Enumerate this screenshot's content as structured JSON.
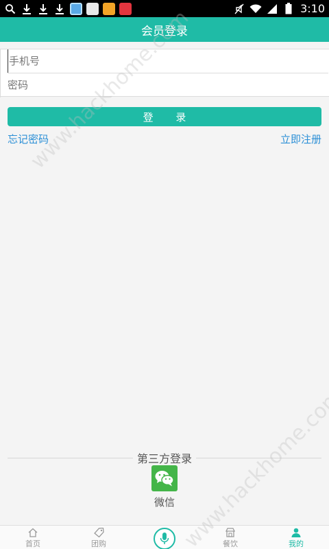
{
  "status_bar": {
    "time": "3:10",
    "left_icons": [
      "search-icon",
      "download-icon",
      "download-icon",
      "download-icon",
      "app-icon-1",
      "app-icon-2",
      "app-icon-3",
      "app-icon-4"
    ],
    "right_icons": [
      "mute-icon",
      "wifi-icon",
      "signal-icon",
      "battery-icon"
    ]
  },
  "header": {
    "title": "会员登录"
  },
  "form": {
    "phone_placeholder": "手机号",
    "password_placeholder": "密码"
  },
  "login_button": {
    "label": "登 录"
  },
  "links": {
    "forgot": "忘记密码",
    "register": "立即注册"
  },
  "third_party": {
    "title": "第三方登录",
    "wechat_label": "微信"
  },
  "bottom_nav": {
    "items": [
      {
        "label": "首页",
        "icon": "home-icon",
        "active": false
      },
      {
        "label": "团购",
        "icon": "tag-icon",
        "active": false
      },
      {
        "label": "",
        "icon": "mic-icon",
        "active": false
      },
      {
        "label": "餐饮",
        "icon": "restaurant-icon",
        "active": false
      },
      {
        "label": "我的",
        "icon": "user-icon",
        "active": true
      }
    ]
  },
  "colors": {
    "accent": "#1fbba6",
    "link": "#2b8fd6",
    "wechat": "#44b549"
  },
  "watermark": "www.hackhome.com"
}
